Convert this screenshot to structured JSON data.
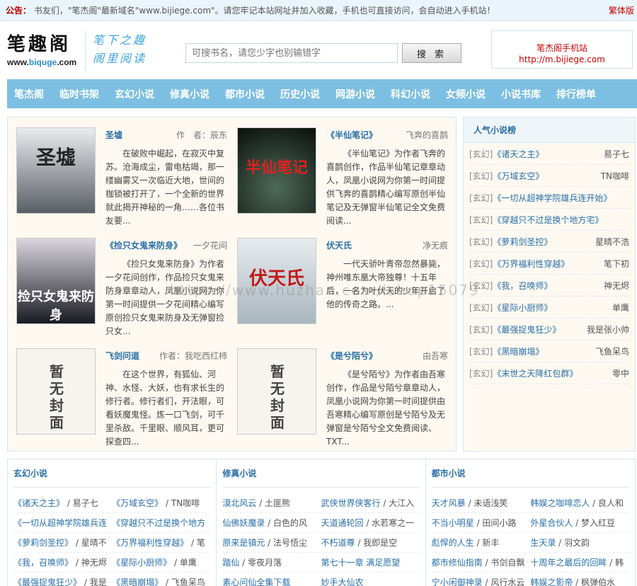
{
  "notice": {
    "label": "公告：",
    "text": "书友们，\"笔杰阁\"最新域名\"www.bijiege.com\"。请您牢记本站网址并加入收藏，手机也可直接访问，会自动进入手机站！",
    "traditional": "繁体版"
  },
  "logo": {
    "name": "笔趣阁",
    "url_pre": "www.",
    "url_accent": "biquge",
    "url_post": ".com"
  },
  "slogan": {
    "line1": "笔下之趣",
    "line2": "阁里阅读"
  },
  "search": {
    "placeholder": "可搜书名，请您少字也别输错字",
    "button": "搜 索"
  },
  "mobile": {
    "title": "笔杰阁手机站",
    "url": "http://m.bijiege.com"
  },
  "nav": [
    "笔杰阁",
    "临时书架",
    "玄幻小说",
    "修真小说",
    "都市小说",
    "历史小说",
    "网游小说",
    "科幻小说",
    "女频小说",
    "小说书库",
    "排行榜单"
  ],
  "books": [
    {
      "title": "圣墟",
      "author": "作　者：辰东",
      "cover": "圣墟",
      "desc": "在破败中崛起，在寂灭中复苏。沧海成尘，雷电枯竭，那一缕幽雾又一次临近大地，世间的枷锁被打开了，一个全新的世界就此揭开神秘的一角……各位书友要..."
    },
    {
      "title": "《半仙笔记》",
      "author": "飞奔的喜鹊",
      "cover": "半仙笔记",
      "desc": "《半仙笔记》为作者飞奔的喜鹊创作，作品半仙笔记章章动人，凤凰小说网为你第一时间提供飞奔的喜鹊精心编写原创半仙笔记及无弹窗半仙笔记全文免费阅读..."
    },
    {
      "title": "《捡只女鬼来防身》",
      "author": "一夕花间",
      "cover": "捡只女鬼来防身",
      "desc": "《捡只女鬼来防身》为作者一夕花间创作，作品捡只女鬼来防身章章动人，凤凰小说网为你第一时间提供一夕花间精心编写原创捡只女鬼来防身及无弹窗捡只女..."
    },
    {
      "title": "伏天氏",
      "author": "净无痕",
      "cover": "伏天氏",
      "desc": "一代天骄叶青帝忽然暴毙，神州唯东凰大帝独尊！十五年后，一名为叶伏天的少年开启了他的传奇之路。..."
    },
    {
      "title": "飞剑问道",
      "author": "作者：我吃西红柿",
      "cover": "暂无封面",
      "desc": "在这个世界，有狐仙、河神、水怪、大妖，也有求长生的修行者。修行者们，开法眼，可看妖魔鬼怪。炼一口飞剑，可千里杀敌。千里眼、顺风耳，更可探查四..."
    },
    {
      "title": "《是兮陌兮》",
      "author": "由吾寒",
      "cover": "暂无封面",
      "desc": "《是兮陌兮》为作者由吾寒创作，作品是兮陌兮章章动人，凤凰小说网为你第一时间提供由吾寒精心编写原创是兮陌兮及无弹窗是兮陌兮全文免费阅读、TXT..."
    }
  ],
  "popular": {
    "title": "人气小说榜",
    "items": [
      {
        "cat": "[玄幻]",
        "name": "《诸天之主》",
        "author": "易子七"
      },
      {
        "cat": "[玄幻]",
        "name": "《万域玄空》",
        "author": "TN咖啡"
      },
      {
        "cat": "[玄幻]",
        "name": "《一切从超神学院雄兵连开始》",
        "author": ""
      },
      {
        "cat": "[玄幻]",
        "name": "《穿越只不过是换个地方宅》",
        "author": ""
      },
      {
        "cat": "[玄幻]",
        "name": "《萝莉剑圣控》",
        "author": "星晴不浩"
      },
      {
        "cat": "[玄幻]",
        "name": "《万界福利性穿越》",
        "author": "笔下初"
      },
      {
        "cat": "[玄幻]",
        "name": "《我，召唤师》",
        "author": "神无烬"
      },
      {
        "cat": "[玄幻]",
        "name": "《星际小厨师》",
        "author": "单鹰"
      },
      {
        "cat": "[玄幻]",
        "name": "《最强捉鬼狂少》",
        "author": "我是张小帅"
      },
      {
        "cat": "[玄幻]",
        "name": "《黑暗崩塌》",
        "author": "飞鱼呆鸟"
      },
      {
        "cat": "[玄幻]",
        "name": "《末世之天降红包群》",
        "author": "零中"
      }
    ]
  },
  "categories": [
    {
      "title": "玄幻小说",
      "rows": [
        [
          "《诸天之主》",
          "易子七",
          "《万域玄空》",
          "TN咖啡"
        ],
        [
          "《一切从超神学院雄兵连",
          "",
          "《穿越只不过是换个地方",
          ""
        ],
        [
          "《萝莉剑圣控》",
          "星晴不",
          "《万界福利性穿越》",
          "笔"
        ],
        [
          "《我，召唤师》",
          "神无烬",
          "《星际小厨师》",
          "单鹰"
        ],
        [
          "《最强捉鬼狂少》",
          "我是",
          "《黑暗崩塌》",
          "飞鱼呆鸟"
        ]
      ]
    },
    {
      "title": "修真小说",
      "rows": [
        [
          "漠北风云",
          "土匪熊",
          "武侠世界侠客行",
          "大江入"
        ],
        [
          "仙佛妖魔录",
          "白色的风",
          "天道通轮回",
          "水若寒之一"
        ],
        [
          "原来是镇元",
          "法号悟尘",
          "不朽道尊",
          "我即是空"
        ],
        [
          "踏仙",
          "零夜月落",
          "第七十一章 满足愿望",
          ""
        ],
        [
          "素心问仙全集下载",
          "",
          "妙手大仙农",
          ""
        ]
      ]
    },
    {
      "title": "都市小说",
      "rows": [
        [
          "天才风暴",
          "未语浅笑",
          "韩娱之咖啡恋人",
          "良人和"
        ],
        [
          "不当小明星",
          "田间小路",
          "外星合伙人",
          "梦入红豆"
        ],
        [
          "彪悍的人生",
          "新丰",
          "生天录",
          "羽文韵"
        ],
        [
          "都市修仙指南",
          "书剑自飘",
          "十周年之最后的回眸",
          "韩"
        ],
        [
          "宁小闲御神录",
          "风行水云",
          "韩娱之影帝",
          "枫弹伯水"
        ]
      ]
    }
  ],
  "watermark": "https://www.huzhan.com/ishop15079"
}
